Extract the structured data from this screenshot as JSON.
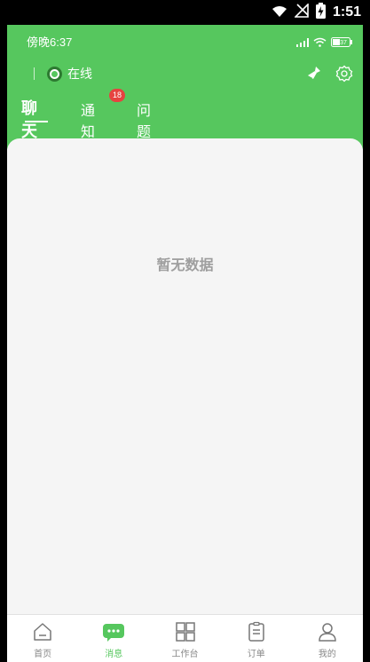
{
  "device": {
    "time": "1:51"
  },
  "app": {
    "status_bar": {
      "time": "傍晚6:37",
      "battery": "37"
    },
    "presence": {
      "label": "在线"
    },
    "tabs": [
      {
        "label": "聊天",
        "active": true
      },
      {
        "label": "通知",
        "badge": "18"
      },
      {
        "label": "问题"
      }
    ],
    "empty_state": "暂无数据",
    "nav": [
      {
        "label": "首页",
        "icon": "home-icon"
      },
      {
        "label": "消息",
        "icon": "message-icon",
        "active": true
      },
      {
        "label": "工作台",
        "icon": "grid-icon"
      },
      {
        "label": "订单",
        "icon": "clipboard-icon"
      },
      {
        "label": "我的",
        "icon": "user-icon"
      }
    ],
    "colors": {
      "accent": "#56c75e",
      "badge": "#e64340",
      "background": "#f5f5f5"
    }
  }
}
